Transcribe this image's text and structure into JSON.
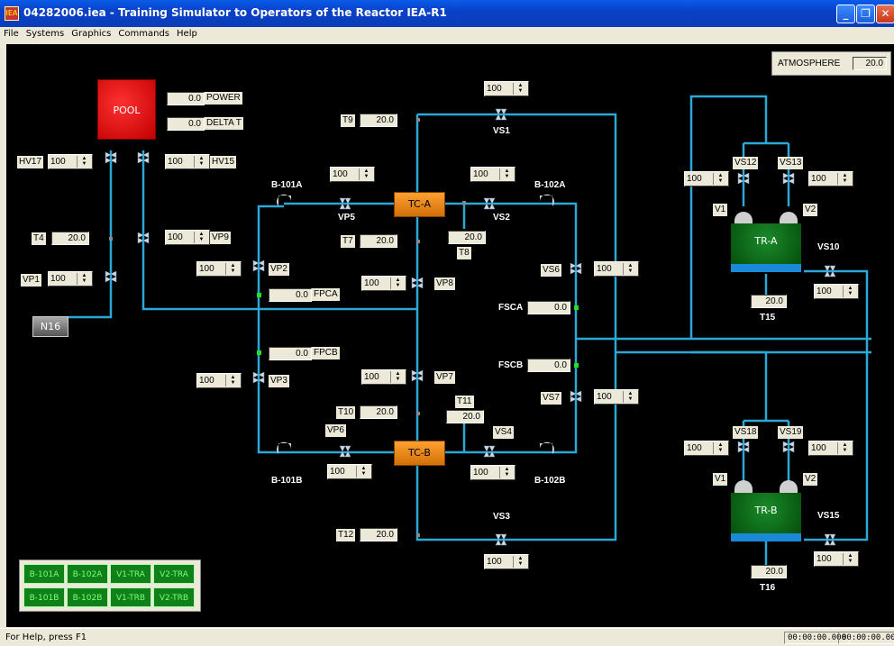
{
  "window": {
    "title": "04282006.iea - Training Simulator to Operators of the Reactor IEA-R1",
    "icon_label": "IEA",
    "minimize": "_",
    "restore": "❐",
    "close": "✕"
  },
  "menu": [
    "File",
    "Systems",
    "Graphics",
    "Commands",
    "Help"
  ],
  "atmosphere": {
    "label": "ATMOSPHERE",
    "value": "20.0"
  },
  "pool": {
    "label": "POOL",
    "power_value": "0.0",
    "power_label": "POWER",
    "delta_value": "0.0",
    "delta_label": "DELTA T"
  },
  "n16": "N16",
  "tc_a": "TC-A",
  "tc_b": "TC-B",
  "tr_a": "TR-A",
  "tr_b": "TR-B",
  "valves": {
    "hv17": {
      "label": "HV17",
      "value": "100"
    },
    "hv15": {
      "label": "HV15",
      "value": "100"
    },
    "vp9": {
      "label": "VP9",
      "value": "100"
    },
    "vp1": {
      "label": "VP1",
      "value": "100"
    },
    "vp2": {
      "label": "VP2",
      "value": "100"
    },
    "vp3": {
      "label": "VP3",
      "value": "100"
    },
    "vp5": {
      "label": "VP5",
      "value": "100"
    },
    "vp6": {
      "label": "VP6",
      "value": "100"
    },
    "vp7": {
      "label": "VP7",
      "value": "100"
    },
    "vp8": {
      "label": "VP8",
      "value": "100"
    },
    "vs1": {
      "label": "VS1",
      "value": "100"
    },
    "vs2": {
      "label": "VS2",
      "value": "100"
    },
    "vs3": {
      "label": "VS3",
      "value": "100"
    },
    "vs4": {
      "label": "VS4",
      "value": "100"
    },
    "vs6": {
      "label": "VS6",
      "value": "100"
    },
    "vs7": {
      "label": "VS7",
      "value": "100"
    },
    "vs10": {
      "label": "VS10",
      "value": "100"
    },
    "vs12": {
      "label": "VS12",
      "value": "100"
    },
    "vs13": {
      "label": "VS13",
      "value": "100"
    },
    "vs15": {
      "label": "VS15",
      "value": "100"
    },
    "vs18": {
      "label": "VS18",
      "value": "100"
    },
    "vs19": {
      "label": "VS19",
      "value": "100"
    }
  },
  "temps": {
    "t4": {
      "label": "T4",
      "value": "20.0"
    },
    "t7": {
      "label": "T7",
      "value": "20.0"
    },
    "t8": {
      "label": "T8",
      "value": "20.0"
    },
    "t9": {
      "label": "T9",
      "value": "20.0"
    },
    "t10": {
      "label": "T10",
      "value": "20.0"
    },
    "t11": {
      "label": "T11",
      "value": "20.0"
    },
    "t12": {
      "label": "T12",
      "value": "20.0"
    },
    "t15": {
      "label": "T15",
      "value": "20.0"
    },
    "t16": {
      "label": "T16",
      "value": "20.0"
    }
  },
  "flows": {
    "fpca": {
      "label": "FPCA",
      "value": "0.0"
    },
    "fpcb": {
      "label": "FPCB",
      "value": "0.0"
    },
    "fsca": {
      "label": "FSCA",
      "value": "0.0"
    },
    "fscb": {
      "label": "FSCB",
      "value": "0.0"
    }
  },
  "pumps": {
    "b101a": "B-101A",
    "b101b": "B-101B",
    "b102a": "B-102A",
    "b102b": "B-102B",
    "v1a": "V1",
    "v2a": "V2",
    "v1b": "V1",
    "v2b": "V2"
  },
  "legend": [
    "B-101A",
    "B-102A",
    "V1-TRA",
    "V2-TRA",
    "B-101B",
    "B-102B",
    "V1-TRB",
    "V2-TRB"
  ],
  "status": {
    "help": "For Help, press F1",
    "time1": "00:00:00.000",
    "time2": "00:00:00.000"
  },
  "colors": {
    "pipe": "#2aa8d8",
    "background": "#000000",
    "indicator": "#20e020"
  }
}
